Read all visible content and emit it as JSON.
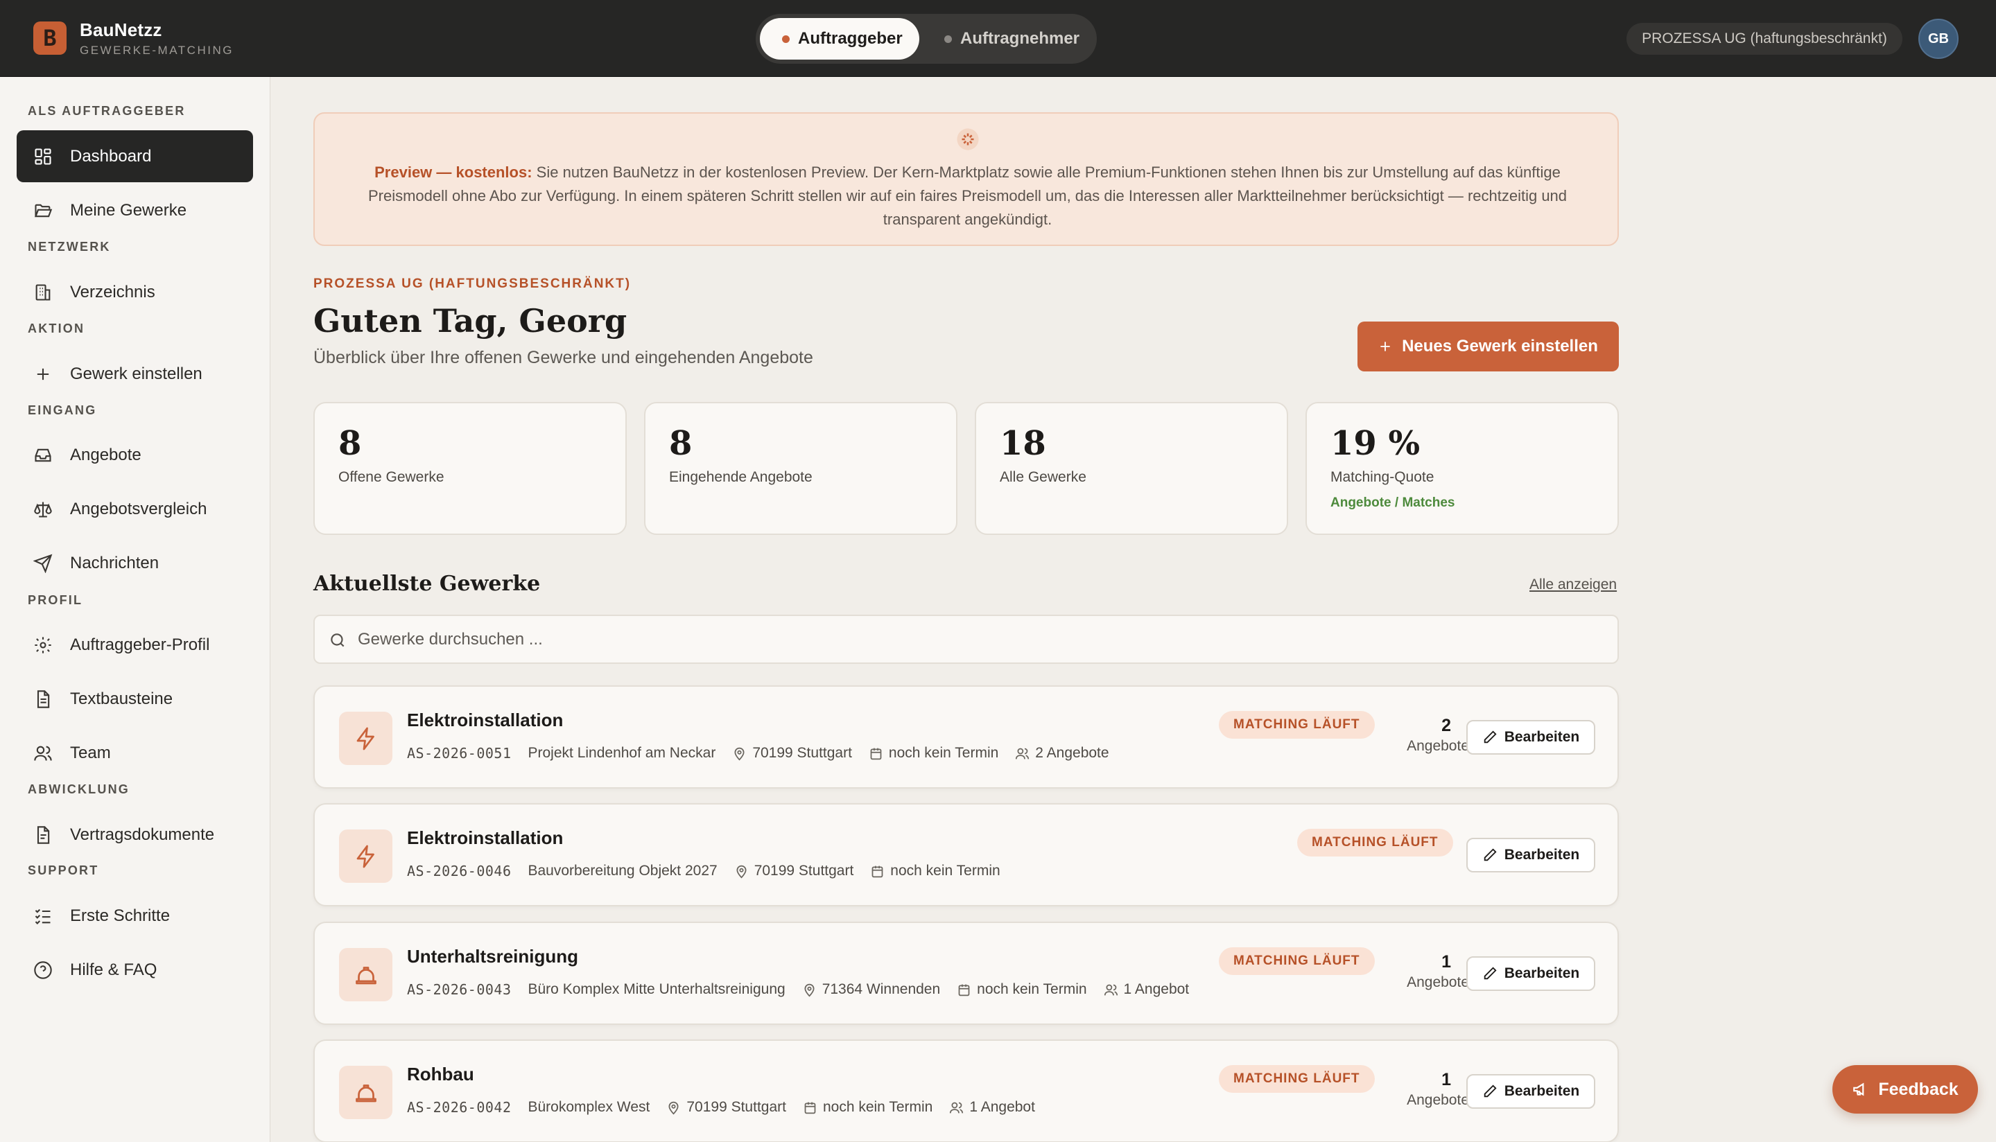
{
  "brand": {
    "name": "BauNetzz",
    "subtitle": "GEWERKE-MATCHING",
    "logo_letter": "B"
  },
  "role_toggle": {
    "active": "Auftraggeber",
    "inactive": "Auftragnehmer"
  },
  "header": {
    "org_chip": "PROZESSA UG (haftungsbeschränkt)",
    "avatar_initials": "GB"
  },
  "sidebar": {
    "sections": {
      "auftraggeber": "ALS AUFTRAGGEBER",
      "netzwerk": "NETZWERK",
      "aktion": "AKTION",
      "eingang": "EINGANG",
      "profil": "PROFIL",
      "abwicklung": "ABWICKLUNG",
      "support": "SUPPORT"
    },
    "items": {
      "dashboard": "Dashboard",
      "meine_gewerke": "Meine Gewerke",
      "verzeichnis": "Verzeichnis",
      "gewerk_einstellen": "Gewerk einstellen",
      "angebote": "Angebote",
      "angebotsvergleich": "Angebotsvergleich",
      "nachrichten": "Nachrichten",
      "auftraggeber_profil": "Auftraggeber-Profil",
      "textbausteine": "Textbausteine",
      "team": "Team",
      "vertragsdokumente": "Vertragsdokumente",
      "erste_schritte": "Erste Schritte",
      "hilfe_faq": "Hilfe & FAQ"
    }
  },
  "banner": {
    "lead": "Preview — kostenlos:",
    "text": "Sie nutzen BauNetzz in der kostenlosen Preview. Der Kern-Marktplatz sowie alle Premium-Funktionen stehen Ihnen bis zur Umstellung auf das künftige Preismodell ohne Abo zur Verfügung. In einem späteren Schritt stellen wir auf ein faires Preismodell um, das die Interessen aller Marktteilnehmer berücksichtigt — rechtzeitig und transparent angekündigt."
  },
  "page": {
    "org_label": "PROZESSA UG (HAFTUNGSBESCHRÄNKT)",
    "greeting": "Guten Tag, Georg",
    "subtitle": "Überblick über Ihre offenen Gewerke und eingehenden Angebote",
    "new_button": "Neues Gewerk einstellen"
  },
  "stats": [
    {
      "value": "8",
      "label": "Offene Gewerke"
    },
    {
      "value": "8",
      "label": "Eingehende Angebote"
    },
    {
      "value": "18",
      "label": "Alle Gewerke"
    },
    {
      "value": "19 %",
      "label": "Matching-Quote",
      "extra": "Angebote / Matches"
    }
  ],
  "recent": {
    "title": "Aktuellste Gewerke",
    "show_all": "Alle anzeigen",
    "search_placeholder": "Gewerke durchsuchen ..."
  },
  "gewerke": [
    {
      "icon": "lightning-icon",
      "title": "Elektroinstallation",
      "code": "AS-2026-0051",
      "project": "Projekt Lindenhof am Neckar",
      "location": "70199 Stuttgart",
      "date": "noch kein Termin",
      "offers_text": "2 Angebote",
      "status": "MATCHING LÄUFT",
      "offers_count": "2",
      "offers_label": "Angebote",
      "edit": "Bearbeiten"
    },
    {
      "icon": "lightning-icon",
      "title": "Elektroinstallation",
      "code": "AS-2026-0046",
      "project": "Bauvorbereitung Objekt 2027",
      "location": "70199 Stuttgart",
      "date": "noch kein Termin",
      "status": "MATCHING LÄUFT",
      "edit": "Bearbeiten"
    },
    {
      "icon": "hardhat-icon",
      "title": "Unterhaltsreinigung",
      "code": "AS-2026-0043",
      "project": "Büro Komplex Mitte Unterhaltsreinigung",
      "location": "71364 Winnenden",
      "date": "noch kein Termin",
      "offers_text": "1 Angebot",
      "status": "MATCHING LÄUFT",
      "offers_count": "1",
      "offers_label": "Angebote",
      "edit": "Bearbeiten"
    },
    {
      "icon": "hardhat-icon",
      "title": "Rohbau",
      "code": "AS-2026-0042",
      "project": "Bürokomplex West",
      "location": "70199 Stuttgart",
      "date": "noch kein Termin",
      "offers_text": "1 Angebot",
      "status": "MATCHING LÄUFT",
      "offers_count": "1",
      "offers_label": "Angebote",
      "edit": "Bearbeiten"
    }
  ],
  "feedback": {
    "label": "Feedback"
  },
  "colors": {
    "accent": "#c9623a",
    "dark": "#262625",
    "success": "#4d8a3c",
    "background": "#f1eee9"
  }
}
